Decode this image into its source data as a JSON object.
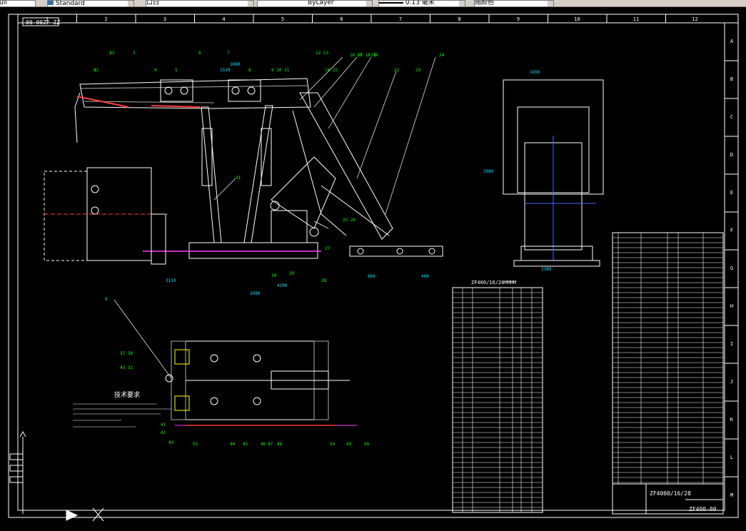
{
  "toolbar": {
    "text_style": "Standard",
    "layer_combo": "口白",
    "linetype": "ByLayer",
    "lineweight": "0.13 毫米",
    "plot_style": "随颜色"
  },
  "drawing": {
    "stamp": "00-00ZF-ZZ",
    "title": "ZF4000/16/28",
    "number": "ZF400-00",
    "tech_req_title": "技术要求",
    "table_header": "ZF400/16/28MMMM",
    "top_columns": [
      "1",
      "2",
      "3",
      "4",
      "5",
      "6",
      "7",
      "8",
      "9",
      "10",
      "11",
      "12"
    ],
    "row_letters": [
      "A",
      "B",
      "C",
      "D",
      "E",
      "F",
      "G",
      "H",
      "I",
      "J",
      "K",
      "L",
      "M"
    ],
    "balloons_side": [
      "1",
      "2",
      "3",
      "4",
      "5",
      "6",
      "7",
      "8",
      "9 10 11",
      "12 13",
      "14 15",
      "16 17 18 19",
      "20",
      "21",
      "22",
      "23",
      "24",
      "25 26",
      "27",
      "28",
      "29",
      "30",
      "31",
      "32",
      "33"
    ],
    "balloons_plan": [
      "8",
      "37 38",
      "43 32",
      "41",
      "42",
      "43",
      "44",
      "45",
      "46",
      "47",
      "48",
      "49",
      "50",
      "54",
      "55"
    ],
    "dims_front": [
      "1450",
      "1980",
      "1380"
    ],
    "dims_side": [
      "1080",
      "1520",
      "3110",
      "2080",
      "4200",
      "860",
      "480"
    ]
  },
  "colors": {
    "background": "#000000",
    "frame": "#ffffff",
    "dim": "#00e5ff",
    "balloon": "#00ff00",
    "leader": "#ffffff",
    "accent_red": "#ff3b3b",
    "accent_magenta": "#ff3bff",
    "accent_blue": "#3b6bff",
    "accent_yellow": "#ffff00"
  }
}
